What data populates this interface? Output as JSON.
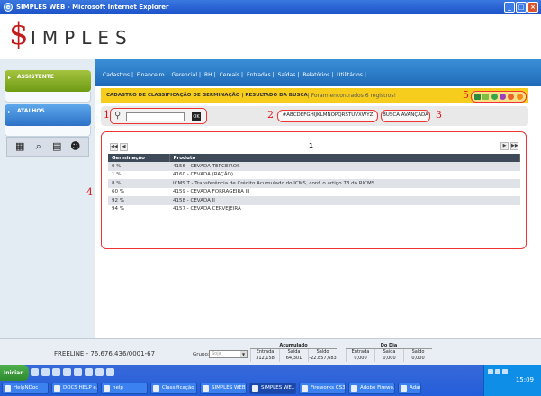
{
  "window": {
    "title": "SIMPLES WEB - Microsoft Internet Explorer"
  },
  "logo": {
    "dollar": "$",
    "text": "IMPLES"
  },
  "sidebar": {
    "panels": [
      {
        "label": "ASSISTENTE"
      },
      {
        "label": "ATALHOS"
      }
    ],
    "tools": [
      "calculator-icon",
      "search-icon",
      "calendar-icon",
      "user-icon"
    ]
  },
  "menu": {
    "items": [
      "Cadastros",
      "Financeiro",
      "Gerencial",
      "RH",
      "Cereais",
      "Entradas",
      "Saídas",
      "Relatórios",
      "Utilitários"
    ]
  },
  "breadcrumb": {
    "bold": "CADASTRO DE CLASSIFICAÇÃO DE GERMINAÇÃO | RESULTADO DA BUSCA",
    "rest": " | Foram encontrados 6 registros!"
  },
  "annotations": [
    "1",
    "2",
    "3",
    "4",
    "5"
  ],
  "search": {
    "placeholder": "",
    "ok_label": "OK",
    "alphabet": "#ABCDEFGHIJKLMNOPQRSTUVXWYZ",
    "advanced": "BUSCA AVANÇADA"
  },
  "pager": {
    "page": "1"
  },
  "table": {
    "headers": [
      "Germinação",
      "Produto"
    ],
    "rows": [
      [
        "0 %",
        "4156 - CEVADA TERCEIROS"
      ],
      [
        "1 %",
        "4160 - CEVADA (RAÇÃO)"
      ],
      [
        "8 %",
        "ICMS T - Transferência de Crédito Acumulado do ICMS, conf. o artigo 73 do RICMS"
      ],
      [
        "60 %",
        "4159 - CEVADA FORRAGEIRA III"
      ],
      [
        "92 %",
        "4158 - CEVADA II"
      ],
      [
        "94 %",
        "4157 - CEVADA CERVEJEIRA"
      ]
    ]
  },
  "status": {
    "freeline": "FREELINE - 76.676.436/0001-67",
    "grupo_label": "Grupo:",
    "grupo_value": "Soja",
    "acumulado": {
      "title": "Acumulado",
      "cols": [
        "Entrada",
        "Saída",
        "Saldo"
      ],
      "vals": [
        "312,158",
        "64,301",
        "-22.857,683"
      ]
    },
    "dodia": {
      "title": "Do Dia",
      "cols": [
        "Entrada",
        "Saída",
        "Saldo"
      ],
      "vals": [
        "0,000",
        "0,000",
        "0,000"
      ]
    }
  },
  "taskbar": {
    "start": "Iniciar",
    "tasks": [
      "HelpNDoc",
      "DOCS HELP e...",
      "help",
      "Classificação ...",
      "SIMPLES WEB...",
      "SIMPLES WE...",
      "Fireworks CS3",
      "Adobe Firewo...",
      "Adan"
    ],
    "clock": "15:09"
  }
}
